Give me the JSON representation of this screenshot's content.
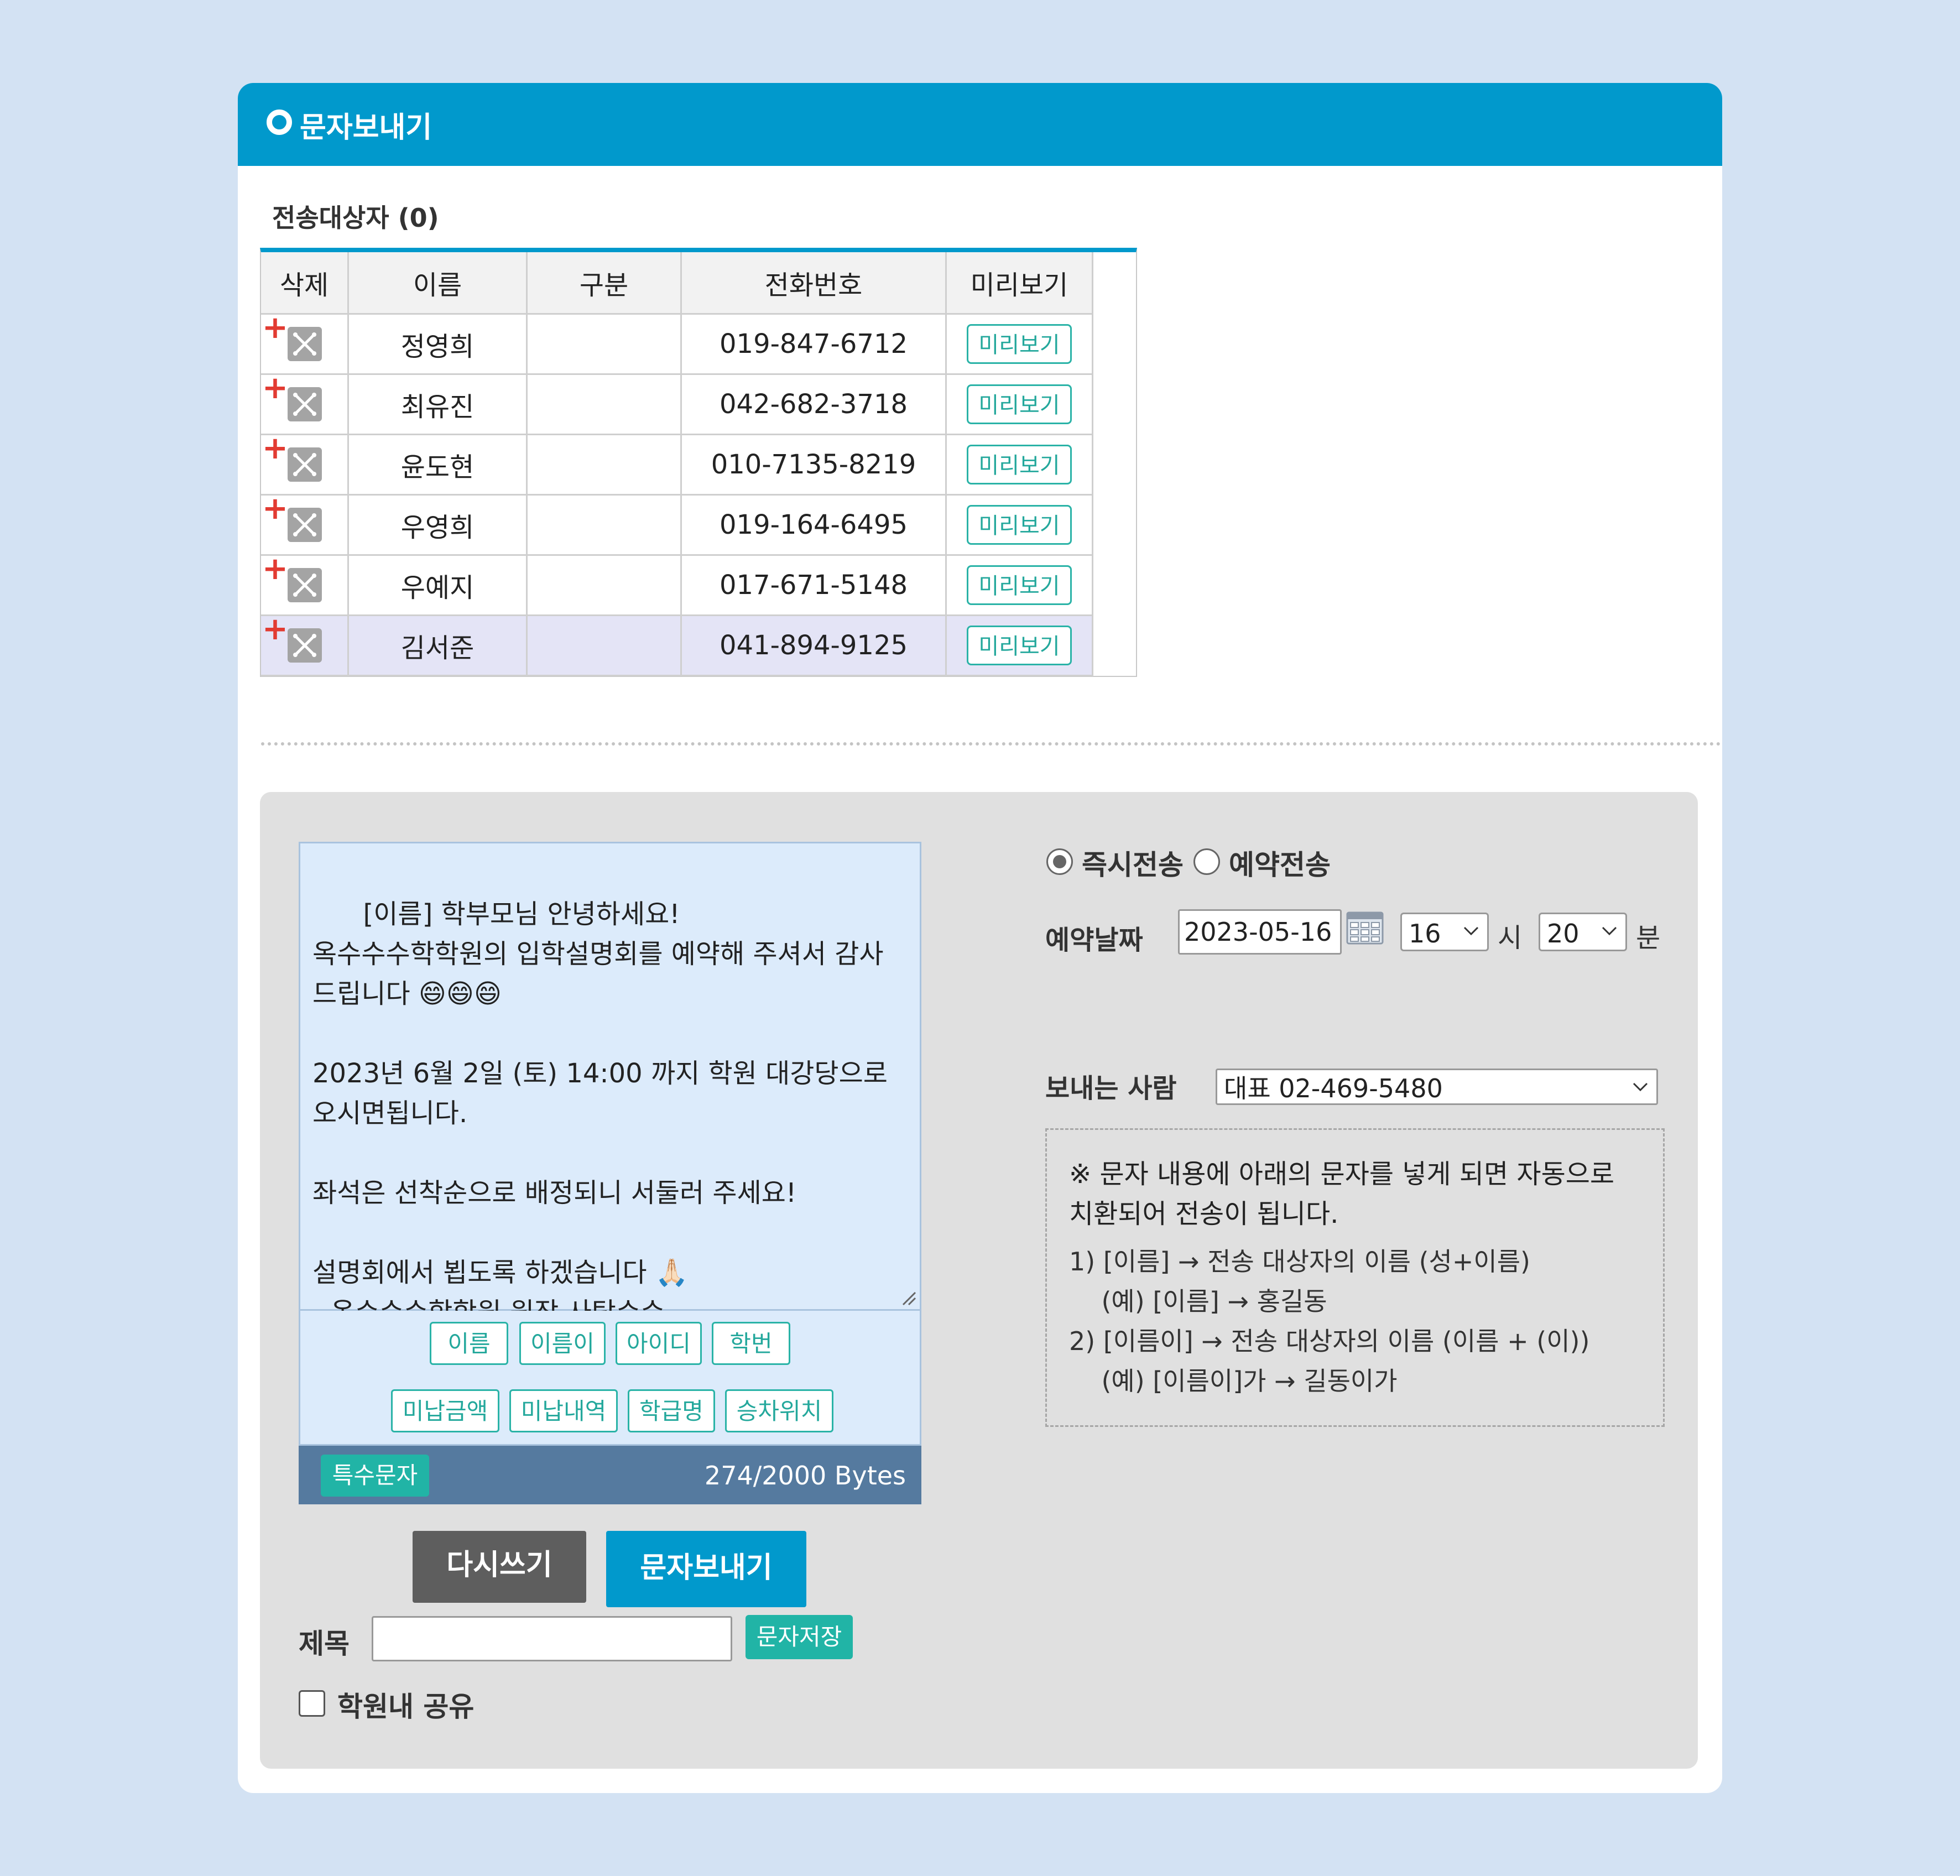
{
  "header": {
    "title": "문자보내기"
  },
  "recipients": {
    "title": "전송대상자 (0)",
    "columns": [
      "삭제",
      "이름",
      "구분",
      "전화번호",
      "미리보기"
    ],
    "rows": [
      {
        "name": "정영희",
        "category": "",
        "phone": "019-847-6712",
        "preview": "미리보기"
      },
      {
        "name": "최유진",
        "category": "",
        "phone": "042-682-3718",
        "preview": "미리보기"
      },
      {
        "name": "윤도현",
        "category": "",
        "phone": "010-7135-8219",
        "preview": "미리보기"
      },
      {
        "name": "우영희",
        "category": "",
        "phone": "019-164-6495",
        "preview": "미리보기"
      },
      {
        "name": "우예지",
        "category": "",
        "phone": "017-671-5148",
        "preview": "미리보기"
      },
      {
        "name": "김서준",
        "category": "",
        "phone": "041-894-9125",
        "preview": "미리보기"
      }
    ]
  },
  "message": {
    "text": "[이름] 학부모님 안녕하세요!\n옥수수수학학원의 입학설명회를 예약해 주셔서 감사드립니다 😄😄😄\n\n2023년 6월 2일 (토) 14:00 까지 학원 대강당으로 오시면됩니다.\n\n좌석은 선착순으로 배정되니 서둘러 주세요!\n\n설명회에서 뵙도록 하겠습니다 🙏🏻\n- 옥수수수학학원 원장 사탕수수 -",
    "tags_row1": [
      "이름",
      "이름이",
      "아이디",
      "학번"
    ],
    "tags_row2": [
      "미납금액",
      "미납내역",
      "학급명",
      "승차위치"
    ],
    "special_chars_label": "특수문자",
    "bytes": "274/2000 Bytes"
  },
  "actions": {
    "rewrite_label": "다시쓰기",
    "send_label": "문자보내기"
  },
  "save": {
    "title_label": "제목",
    "title_value": "",
    "save_label": "문자저장",
    "share_label": "학원내 공유",
    "share_checked": false
  },
  "send_options": {
    "immediate_label": "즉시전송",
    "scheduled_label": "예약전송",
    "selected": "즉시전송",
    "date_label": "예약날짜",
    "date_value": "2023-05-16",
    "hour_value": "16",
    "hour_unit": "시",
    "minute_value": "20",
    "minute_unit": "분",
    "sender_label": "보내는 사람",
    "sender_value": "대표 02-469-5480"
  },
  "notice": {
    "main": "※ 문자 내용에 아래의 문자를 넣게 되면 자동으로 치환되어 전송이 됩니다.",
    "lines": [
      "1) [이름] → 전송 대상자의 이름 (성+이름)",
      "    (예) [이름] → 홍길동",
      "2) [이름이] → 전송 대상자의 이름 (이름 + (이))",
      "    (예) [이름이]가 → 길동이가"
    ]
  },
  "colors": {
    "header": "#0199cc",
    "teal": "#21b4a6",
    "counter_bar": "#557a9f",
    "background": "#d3e2f3"
  }
}
